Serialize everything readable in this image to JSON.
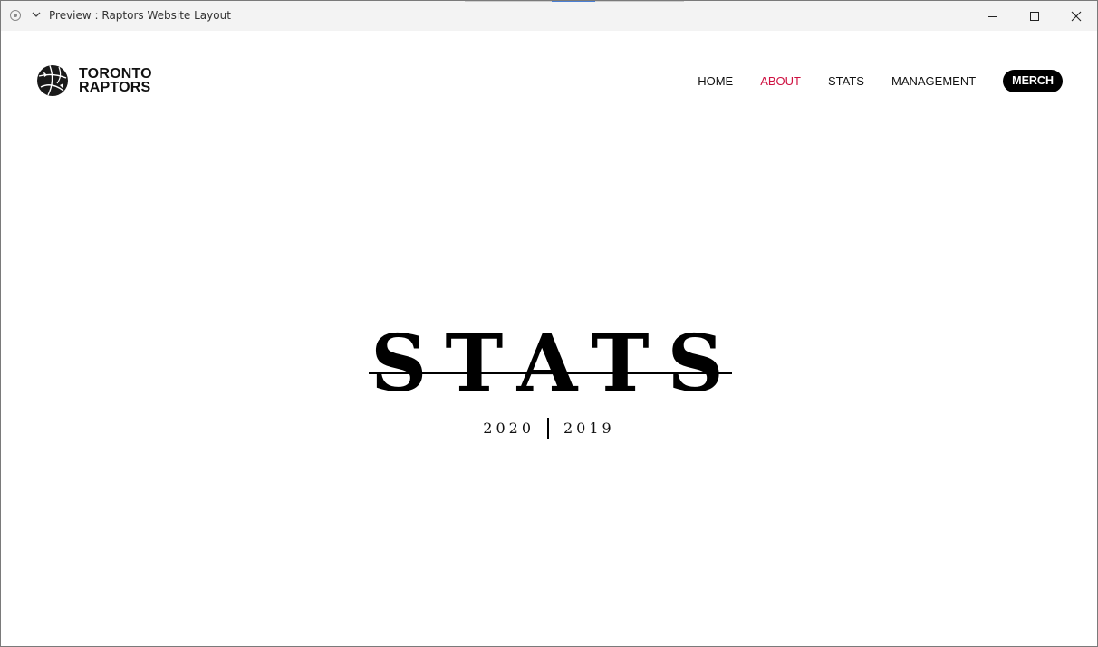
{
  "window": {
    "title": "Preview : Raptors Website Layout",
    "controls": {
      "minimize_icon": "minimize-icon",
      "maximize_icon": "maximize-icon",
      "close_icon": "close-icon"
    }
  },
  "brand": {
    "line1": "TORONTO",
    "line2": "RAPTORS",
    "logo_icon": "raptors-ball-icon"
  },
  "nav": {
    "items": [
      {
        "label": "HOME",
        "active": false
      },
      {
        "label": "ABOUT",
        "active": true
      },
      {
        "label": "STATS",
        "active": false
      },
      {
        "label": "MANAGEMENT",
        "active": false
      }
    ],
    "merch_label": "MERCH"
  },
  "hero": {
    "title": "STATS",
    "year_left": "2020",
    "year_right": "2019"
  },
  "colors": {
    "accent": "#ce1141",
    "text": "#111111",
    "merch_bg": "#000000"
  }
}
